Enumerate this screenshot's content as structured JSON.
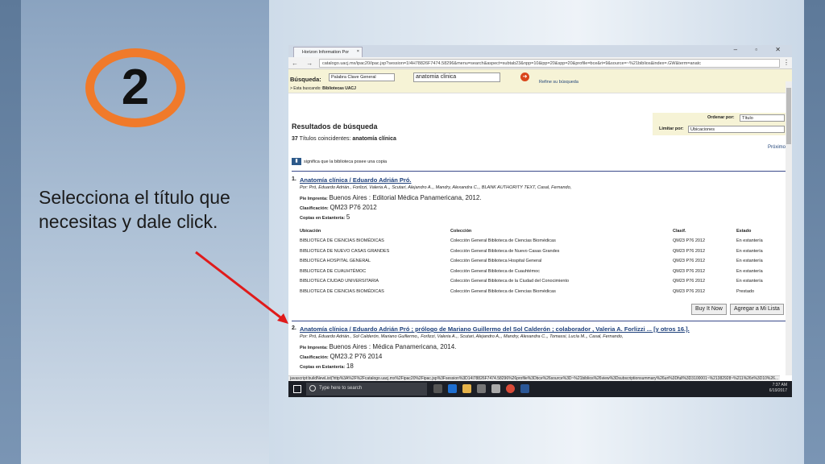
{
  "slide": {
    "number": "2",
    "instruction": "Selecciona el título que necesitas y dale click."
  },
  "browser": {
    "tab_title": "Horizon Information Por",
    "url": "catalogo.uacj.mx/ipac20/ipac.jsp?session=1I4H78826F7474.58296&menu=search&aspect=subtab23&npp=10&ipp=20&spp=20&profile=bce&ri=9&source=~%21biblios&index=.GW&term=anatc"
  },
  "search": {
    "label": "Búsqueda:",
    "type_select": "Palabra Clave General",
    "query": "anatomia clinica",
    "refine": "Refine su búsqueda",
    "searching_in_label": "> Esta buscando:",
    "searching_in": "Bibliotecas UACJ"
  },
  "sort": {
    "order_label": "Ordenar por:",
    "order_value": "Título",
    "limit_label": "Limitar por:",
    "limit_value": "Ubicaciones"
  },
  "results": {
    "heading": "Resultados de búsqueda",
    "count": "37",
    "count_text": "Títulos coincidentes:",
    "term": "anatomía clínica",
    "next": "Próximo",
    "copy_note": "significa que la biblioteca posee una copia"
  },
  "labels": {
    "imprint": "Pie Imprenta:",
    "classification": "Clasificación:",
    "copies": "Copias en Estantería:",
    "col_location": "Ubicación",
    "col_collection": "Colección",
    "col_class": "Clasif.",
    "col_status": "Estado",
    "buy": "Buy It Now",
    "add": "Agregar a Mi Lista"
  },
  "records": [
    {
      "num": "1.",
      "title": "Anatomía clínica / Eduardo Adrián Pró.",
      "by": "Por: Pró, Eduardo Adrián., Forlizzi, Valeria A.,, Scutari, Alejandro A.,, Mandry, Alexandra C.,, BLANK AUTHORITY TEXT, Casal, Fernando,",
      "imprint": "Buenos Aires : Editorial Médica Panamericana, 2012.",
      "class": "QM23 P76 2012",
      "copies": "5",
      "holdings": [
        [
          "BIBLIOTECA DE CIENCIAS BIOMÉDICAS",
          "Colección General Biblioteca de Ciencias Biomédicas",
          "QM23 P76 2012",
          "En estantería"
        ],
        [
          "BIBLIOTECA DE NUEVO CASAS GRANDES",
          "Colección General Biblioteca de Nuevo Casas Grandes",
          "QM23 P76 2012",
          "En estantería"
        ],
        [
          "BIBLIOTECA HOSPITAL GENERAL",
          "Colección General Biblioteca Hospital General",
          "QM23 P76 2012",
          "En estantería"
        ],
        [
          "BIBLIOTECA DE CUAUHTÉMOC",
          "Colección General Biblioteca de Cuauhtémoc",
          "QM23 P76 2012",
          "En estantería"
        ],
        [
          "BIBLIOTECA CIUDAD UNIVERSITARIA",
          "Colección General Biblioteca de la Ciudad del Conocimiento",
          "QM23 P76 2012",
          "En estantería"
        ],
        [
          "BIBLIOTECA DE CIENCIAS BIOMÉDICAS",
          "Colección General Biblioteca de Ciencias Biomédicas",
          "QM23 P76 2012",
          "Prestado"
        ]
      ]
    },
    {
      "num": "2.",
      "title": "Anatomía clínica / Eduardo Adrián Pró ; prólogo de Mariano Guillermo del Sol Calderón ; colaborador , Valeria A. Forlizzi ... [y otros 16.].",
      "by": "Por: Pró, Eduardo Adrián., Sol Calderón, Mariano Guillermo,, Forlizzi, Valeria A.,, Scutari, Alejandro A.,, Mandry, Alexandra C.,, Tomassi, Lucía M.,, Casal, Fernando,",
      "imprint": "Buenos Aires : Médica Panamericana, 2014.",
      "class": "QM23.2 P76 2014",
      "copies": "18"
    }
  ],
  "status_url": "javascript:buildNewList('http%3A%2F%2Fcatalogo.uacj.mx%2Fipac20%2Fipac.jsp%3Fsession%3D14I78826F7474.58296%26profile%3Dbce%26source%3D~%21biblios%26view%3Dsubscriptionsummary%26uri%3Dfull%3D3100001~%21382928~%211%26ri%3D10%26...",
  "taskbar": {
    "search_placeholder": "Type here to search",
    "time": "7:37 AM",
    "date": "6/19/2017"
  },
  "colors": {
    "accent_ring": "#f07a2a",
    "link": "#1d3f7a",
    "arrow": "#e01b1b"
  }
}
